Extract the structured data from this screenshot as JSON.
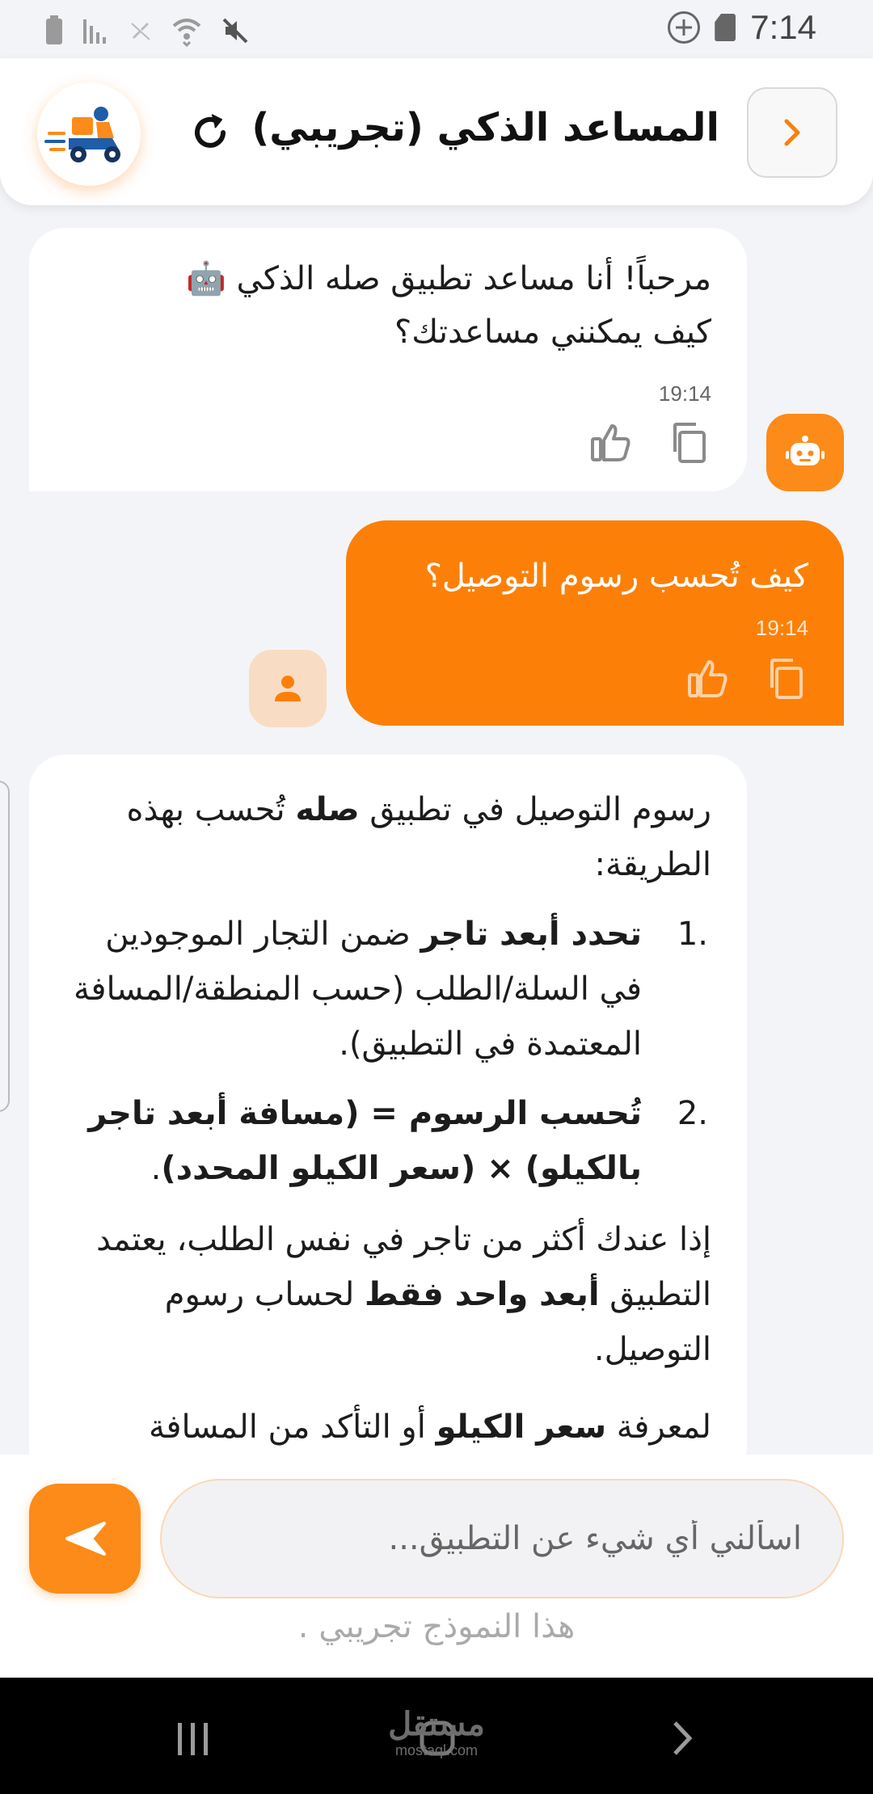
{
  "status_bar": {
    "time": "7:14"
  },
  "header": {
    "title": "المساعد الذكي (تجريبي)"
  },
  "messages": {
    "welcome": {
      "line1": "مرحباً! أنا مساعد تطبيق صله الذكي 🤖",
      "line2": "كيف يمكنني مساعدتك؟",
      "time": "19:14"
    },
    "user": {
      "text": "كيف تُحسب رسوم التوصيل؟",
      "time": "19:14"
    },
    "answer": {
      "p1_a": "رسوم التوصيل في تطبيق ",
      "p1_bold": "صله",
      "p1_b": " تُحسب بهذه الطريقة:",
      "item1_num": ".1",
      "item1_bold": "تحدد أبعد تاجر",
      "item1_text": " ضمن التجار الموجودين في السلة/الطلب (حسب المنطقة/المسافة المعتمدة في التطبيق).",
      "item2_num": ".2",
      "item2_bold": "تُحسب الرسوم = (مسافة أبعد تاجر بالكيلو) × (سعر الكيلو المحدد)",
      "item2_text": ".",
      "p3_a": "إذا عندك أكثر من تاجر في نفس الطلب، يعتمد التطبيق ",
      "p3_bold": "أبعد واحد فقط",
      "p3_b": " لحساب رسوم التوصيل.",
      "p4_a": "لمعرفة ",
      "p4_bold": "سعر الكيلو",
      "p4_b": " أو التأكد من المسافة"
    }
  },
  "input": {
    "placeholder": "اسألني أي شيء عن التطبيق...",
    "disclaimer": "هذا النموذج تجريبي ."
  },
  "watermark": {
    "main": "مستقل",
    "sub": "mostaql.com"
  },
  "colors": {
    "accent": "#fc8008",
    "accent_light": "#fc8b19",
    "avatar_user_bg": "#f9dcc4"
  },
  "icons": {
    "back": "chevron-right-icon",
    "refresh": "refresh-icon",
    "bot": "robot-icon",
    "user": "person-icon",
    "like": "thumbs-up-icon",
    "copy": "copy-icon",
    "send": "send-icon"
  }
}
